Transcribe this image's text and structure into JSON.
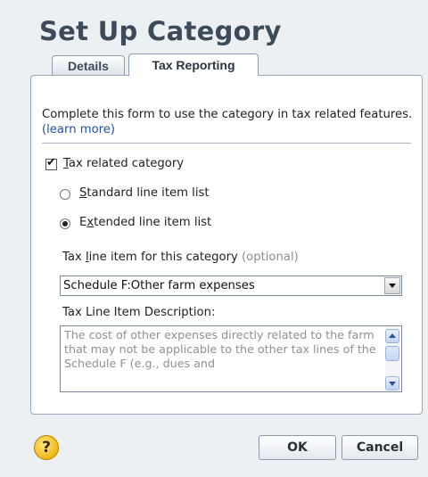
{
  "dialog": {
    "title": "Set Up Category"
  },
  "tabs": [
    {
      "label": "Details",
      "active": false
    },
    {
      "label": "Tax Reporting",
      "active": true
    }
  ],
  "intro": {
    "text": "Complete this form to use the category in tax related features.",
    "link": "(learn more)"
  },
  "tax_related": {
    "checked": true,
    "label_first": "T",
    "label_rest": "ax related category"
  },
  "radios": {
    "standard": {
      "u": "S",
      "rest": "tandard line item list",
      "selected": false
    },
    "extended": {
      "pre": "E",
      "u": "x",
      "rest": "tended line item list",
      "selected": true
    }
  },
  "tax_line": {
    "label_pre": "Tax ",
    "label_u": "l",
    "label_rest": "ine item for this category",
    "optional": "(optional)",
    "selected": "Schedule F:Other farm expenses"
  },
  "description": {
    "label": "Tax Line Item Description:",
    "text": "The cost of other expenses directly related to the farm that may not be applicable to the other tax lines of the Schedule F (e.g., dues and"
  },
  "buttons": {
    "ok": "OK",
    "cancel": "Cancel",
    "help": "?"
  },
  "icons": {
    "help": "help-question-icon",
    "check": "checkmark-icon"
  }
}
